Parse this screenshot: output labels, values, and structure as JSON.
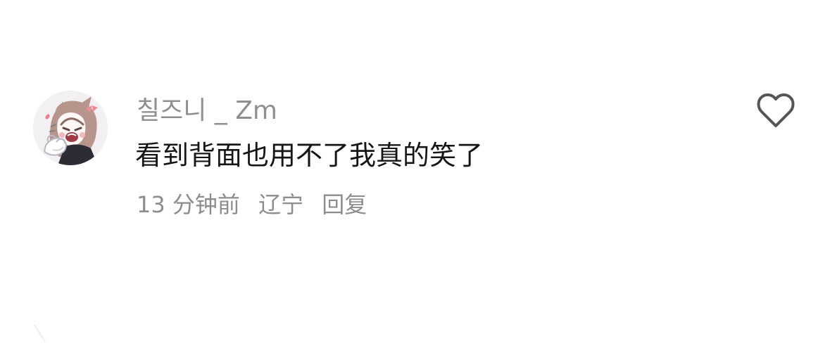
{
  "comment": {
    "username": "칠즈니 _ Zm",
    "text": "看到背面也用不了我真的笑了",
    "time": "13 分钟前",
    "location": "辽宁",
    "reply_label": "回复",
    "avatar_icon": "anime-girl-avatar",
    "like_icon": "heart-outline-icon"
  },
  "colors": {
    "background": "#ffffff",
    "username": "#8f8f8f",
    "text": "#161616",
    "meta": "#8d8d8d",
    "icon": "#555555"
  }
}
